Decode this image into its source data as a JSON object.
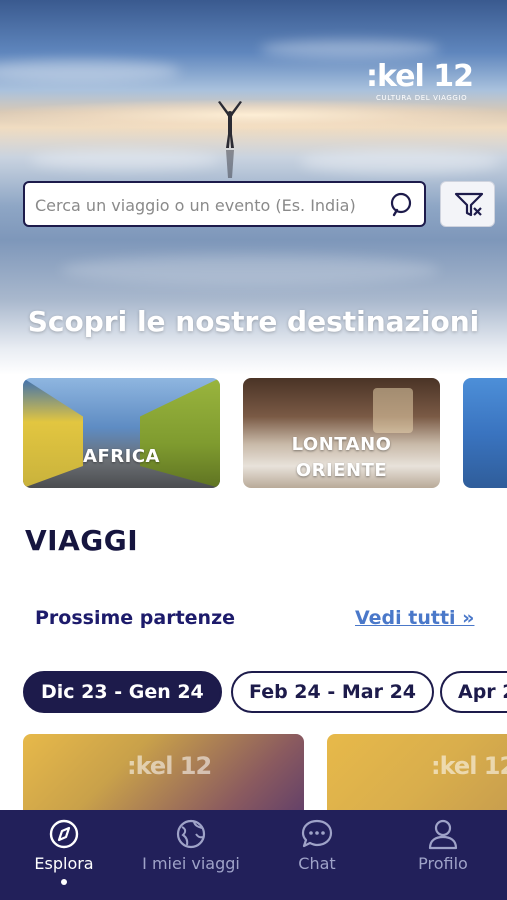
{
  "brand": {
    "logo_text": ":kel 12",
    "tagline": "CULTURA DEL VIAGGIO"
  },
  "search": {
    "placeholder": "Cerca un viaggio o un evento (Es. India)"
  },
  "hero": {
    "title": "Scopri le nostre destinazioni"
  },
  "destinations": [
    {
      "label": "AFRICA"
    },
    {
      "label": "LONTANO ORIENTE",
      "line1": "LONTANO",
      "line2": "ORIENTE"
    }
  ],
  "trips": {
    "section_title": "VIAGGI",
    "subtitle": "Prossime partenze",
    "see_all": "Vedi tutti »",
    "date_chips": [
      "Dic 23 - Gen 24",
      "Feb 24 - Mar 24",
      "Apr 2"
    ],
    "active_chip_index": 0,
    "card_logo": ":kel 12"
  },
  "tabbar": {
    "items": [
      {
        "label": "Esplora",
        "icon": "compass-icon",
        "active": true
      },
      {
        "label": "I miei viaggi",
        "icon": "globe-icon",
        "active": false
      },
      {
        "label": "Chat",
        "icon": "chat-bubble-icon",
        "active": false
      },
      {
        "label": "Profilo",
        "icon": "user-icon",
        "active": false
      }
    ]
  },
  "colors": {
    "navy": "#1d1b4b",
    "tabbar": "#22205a",
    "link": "#4a78c9",
    "card_gold": "#e7b94a"
  }
}
